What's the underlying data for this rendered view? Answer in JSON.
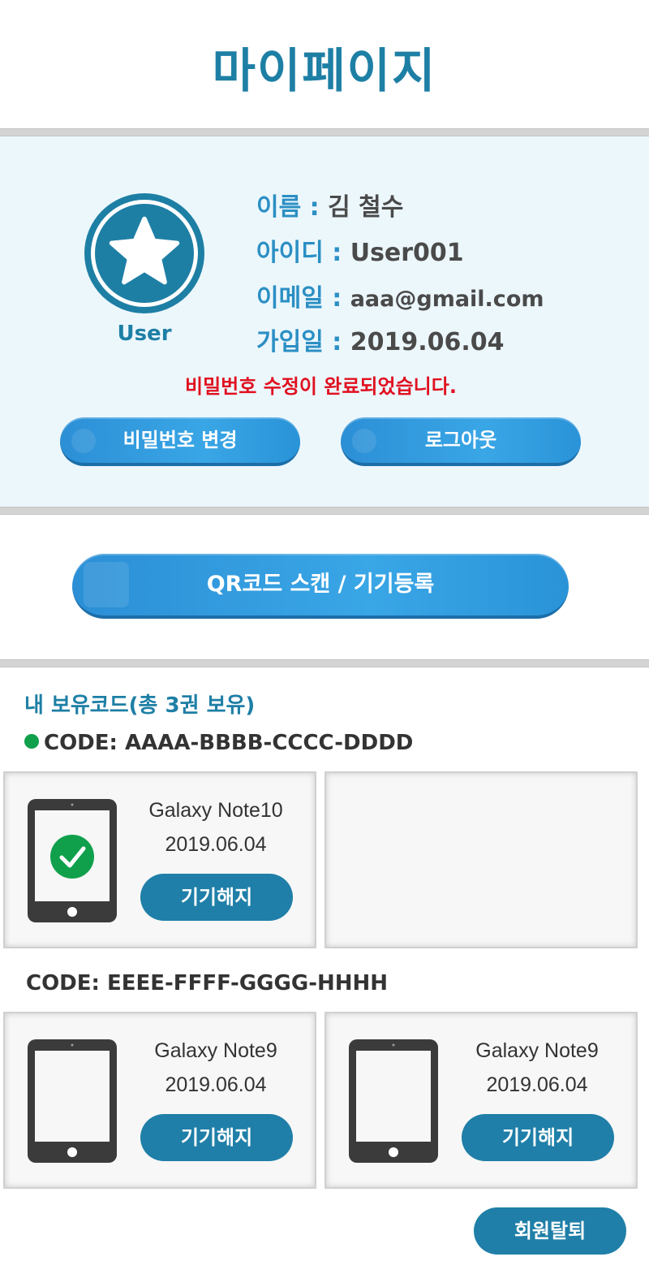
{
  "page": {
    "title": "마이페이지"
  },
  "profile": {
    "avatar_label": "User",
    "name_label": "이름 :",
    "name_value": "김 철수",
    "id_label": "아이디 :",
    "id_value": "User001",
    "email_label": "이메일 :",
    "email_value": "aaa@gmail.com",
    "join_label": "가입일 :",
    "join_value": "2019.06.04",
    "notice": "비밀번호 수정이 완료되었습니다.",
    "change_password_label": "비밀번호 변경",
    "logout_label": "로그아웃"
  },
  "scan": {
    "button_label": "QR코드 스캔 / 기기등록"
  },
  "codes": {
    "section_title": "내 보유코드(총 3권 보유)",
    "groups": [
      {
        "code": "CODE: AAAA-BBBB-CCCC-DDDD",
        "active": true,
        "devices": [
          {
            "model": "Galaxy Note10",
            "date": "2019.06.04",
            "release_label": "기기해지",
            "verified": true
          }
        ]
      },
      {
        "code": "CODE: EEEE-FFFF-GGGG-HHHH",
        "active": false,
        "devices": [
          {
            "model": "Galaxy Note9",
            "date": "2019.06.04",
            "release_label": "기기해지",
            "verified": false
          },
          {
            "model": "Galaxy Note9",
            "date": "2019.06.04",
            "release_label": "기기해지",
            "verified": false
          }
        ]
      }
    ]
  },
  "footer": {
    "withdraw_label": "회원탈퇴"
  },
  "colors": {
    "primary": "#1e7fa5",
    "accent": "#2b8fc4",
    "notice": "#e01020",
    "active_dot": "#10a04c",
    "panel_bg": "#ecf7fc"
  }
}
